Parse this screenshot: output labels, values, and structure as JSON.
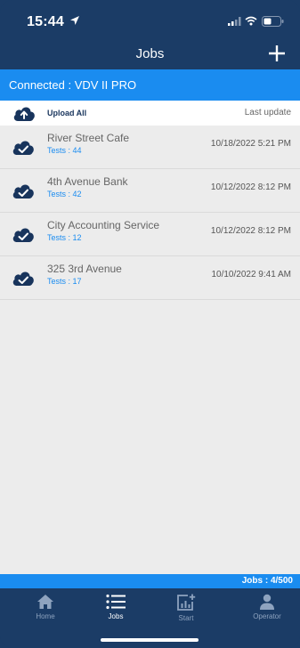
{
  "status_bar": {
    "time": "15:44"
  },
  "header": {
    "title": "Jobs",
    "add_icon": "plus-icon"
  },
  "connection": {
    "text": "Connected : VDV II PRO"
  },
  "upload": {
    "label": "Upload All",
    "last_update_label": "Last update"
  },
  "jobs": [
    {
      "name": "River Street Cafe",
      "tests": "Tests : 44",
      "date": "10/18/2022 5:21 PM"
    },
    {
      "name": "4th Avenue Bank",
      "tests": "Tests : 42",
      "date": "10/12/2022 8:12 PM"
    },
    {
      "name": "City Accounting Service",
      "tests": "Tests : 12",
      "date": "10/12/2022 8:12 PM"
    },
    {
      "name": "325 3rd Avenue",
      "tests": "Tests : 17",
      "date": "10/10/2022 9:41 AM"
    }
  ],
  "footer": {
    "jobs_count": "Jobs : 4/500"
  },
  "tabs": [
    {
      "label": "Home",
      "icon": "home-icon",
      "active": false
    },
    {
      "label": "Jobs",
      "icon": "list-icon",
      "active": true
    },
    {
      "label": "Start",
      "icon": "chart-add-icon",
      "active": false
    },
    {
      "label": "Operator",
      "icon": "user-icon",
      "active": false
    }
  ],
  "colors": {
    "navy": "#1b3c66",
    "accent_blue": "#1a8cf0",
    "list_background": "#ececec",
    "cloud_icon": "#18345c"
  }
}
